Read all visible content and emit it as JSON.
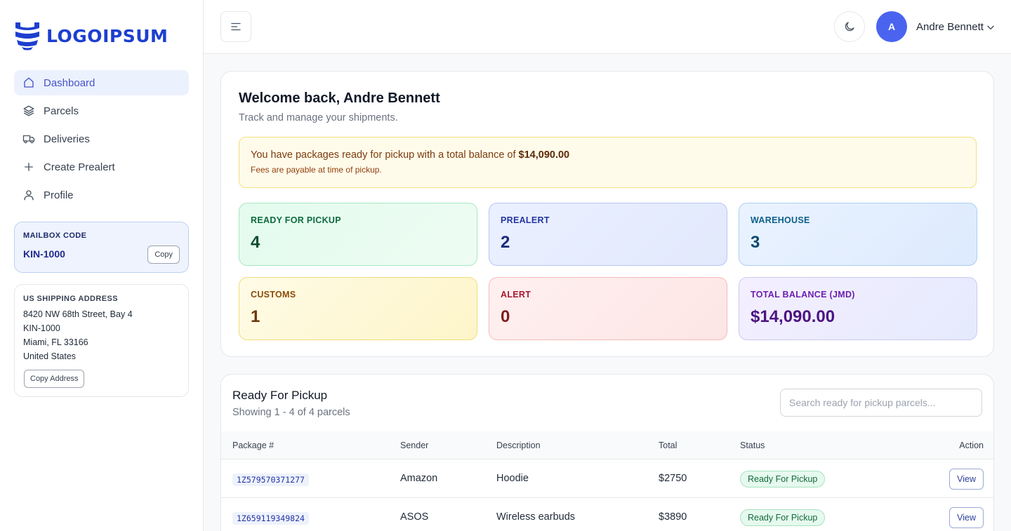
{
  "brand": {
    "logo_text": "LOGOIPSUM",
    "color": "#1d3fcf"
  },
  "sidebar": {
    "items": [
      {
        "label": "Dashboard",
        "icon": "home-icon",
        "active": true
      },
      {
        "label": "Parcels",
        "icon": "layers-icon"
      },
      {
        "label": "Deliveries",
        "icon": "truck-icon"
      },
      {
        "label": "Create Prealert",
        "icon": "plus-icon"
      },
      {
        "label": "Profile",
        "icon": "user-icon"
      }
    ],
    "mailbox": {
      "label": "MAILBOX CODE",
      "code": "KIN-1000",
      "copy_label": "Copy"
    },
    "address": {
      "label": "US SHIPPING ADDRESS",
      "lines": [
        "8420 NW 68th Street, Bay 4",
        "KIN-1000",
        "Miami, FL 33166",
        "United States"
      ],
      "copy_label": "Copy Address"
    }
  },
  "header": {
    "avatar_initial": "A",
    "user_name": "Andre Bennett"
  },
  "welcome": {
    "title": "Welcome back, Andre Bennett",
    "subtitle": "Track and manage your shipments.",
    "alert_text": "You have packages ready for pickup with a total balance of ",
    "alert_amount": "$14,090.00",
    "alert_sub": "Fees are payable at time of pickup."
  },
  "stats": [
    {
      "label": "READY FOR PICKUP",
      "value": "4"
    },
    {
      "label": "PREALERT",
      "value": "2"
    },
    {
      "label": "WAREHOUSE",
      "value": "3"
    },
    {
      "label": "CUSTOMS",
      "value": "1"
    },
    {
      "label": "ALERT",
      "value": "0"
    },
    {
      "label": "TOTAL BALANCE (JMD)",
      "value": "$14,090.00"
    }
  ],
  "table": {
    "title": "Ready For Pickup",
    "subtitle": "Showing 1 - 4 of 4 parcels",
    "search_placeholder": "Search ready for pickup parcels...",
    "columns": [
      "Package #",
      "Sender",
      "Description",
      "Total",
      "Status",
      "Action"
    ],
    "rows": [
      {
        "package": "1Z579570371277",
        "sender": "Amazon",
        "description": "Hoodie",
        "total": "$2750",
        "status": "Ready For Pickup",
        "action": "View"
      },
      {
        "package": "1Z659119349824",
        "sender": "ASOS",
        "description": "Wireless earbuds",
        "total": "$3890",
        "status": "Ready For Pickup",
        "action": "View"
      }
    ]
  }
}
